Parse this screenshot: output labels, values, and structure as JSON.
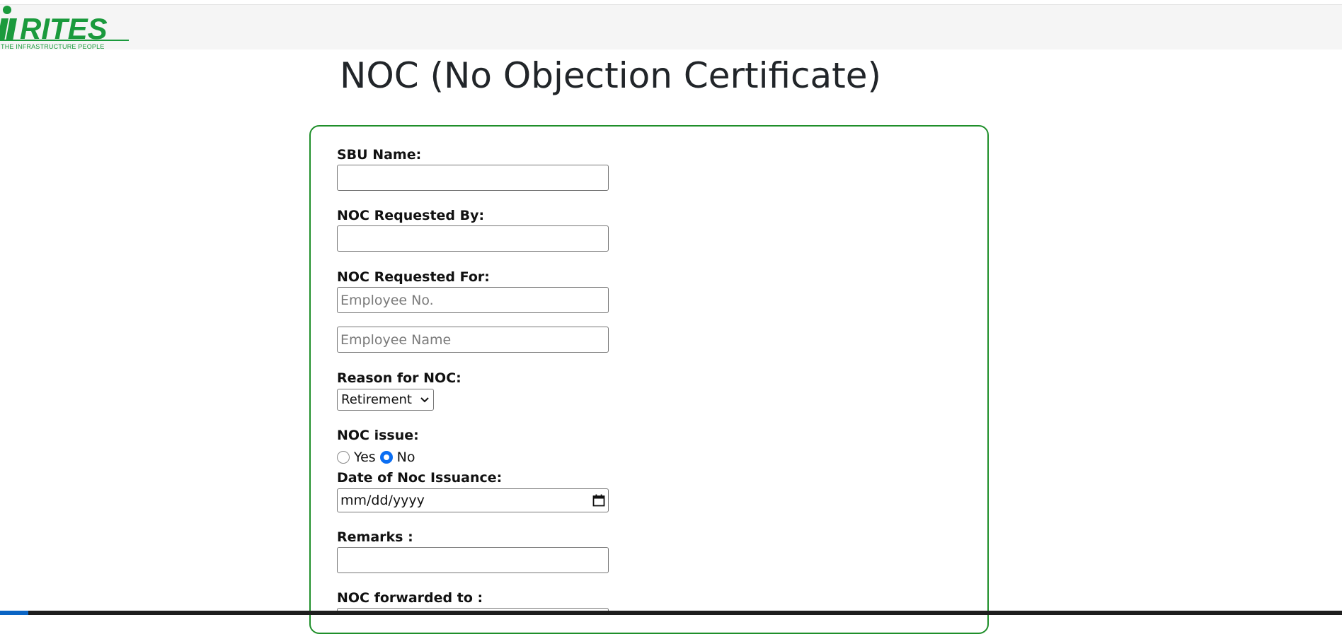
{
  "logo": {
    "brand": "RITES",
    "tagline": "THE INFRASTRUCTURE PEOPLE"
  },
  "page_title": "NOC (No Objection Certificate)",
  "form": {
    "sbu_name": {
      "label": "SBU Name:",
      "value": ""
    },
    "requested_by": {
      "label": "NOC Requested By:",
      "value": ""
    },
    "requested_for": {
      "label": "NOC Requested For:",
      "employee_no_placeholder": "Employee No.",
      "employee_name_placeholder": "Employee Name"
    },
    "reason": {
      "label": "Reason for NOC:",
      "selected": "Retirement"
    },
    "noc_issue": {
      "label": "NOC issue:",
      "options": [
        {
          "label": "Yes",
          "checked": false
        },
        {
          "label": "No",
          "checked": true
        }
      ]
    },
    "issuance_date": {
      "label": "Date of Noc Issuance:",
      "placeholder": "mm/dd/yyyy"
    },
    "remarks": {
      "label": "Remarks :",
      "value": ""
    },
    "forwarded_to": {
      "label": "NOC forwarded to :"
    }
  },
  "colors": {
    "card_border": "#1f8f2a",
    "brand_green": "#1a9a3c",
    "radio_accent": "#0b6ef2"
  },
  "icons": [
    "calendar-icon",
    "chevron-down-icon"
  ]
}
